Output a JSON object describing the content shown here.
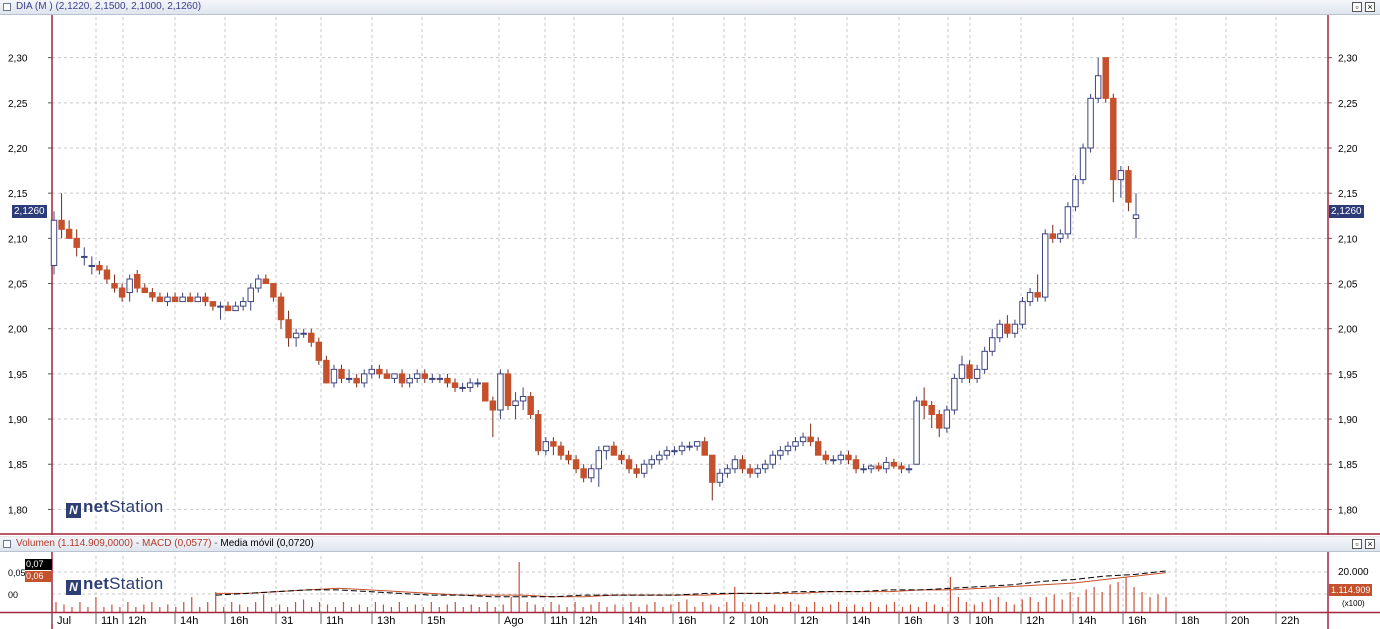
{
  "main_panel": {
    "title_symbol": "DIA (M )",
    "title_values": "(2,1220, 2,1500, 2,1000, 2,1260)",
    "last_price": "2,1260",
    "y_ticks": [
      "2,30",
      "2,25",
      "2,20",
      "2,15",
      "2,10",
      "2,05",
      "2,00",
      "1,95",
      "1,90",
      "1,85",
      "1,80"
    ],
    "logo_bold": "net",
    "logo_rest": "Station",
    "logo_mark": "N"
  },
  "lower_panel": {
    "legend_volume": "Volumen (1.114.909,0000)",
    "legend_macd": "MACD (0,0577)",
    "legend_ma": "Media móvil (0,0720)",
    "left_tag_top": "0,07",
    "left_tag_bottom": "0,06",
    "left_zero": "00",
    "left_mid": "0,05",
    "right_tick": "20.000",
    "right_tag": "1.114.909",
    "right_scale": "(x100)"
  },
  "x_axis_labels": [
    "Jul",
    "11h",
    "12h",
    "14h",
    "16h",
    "31",
    "11h",
    "13h",
    "15h",
    "Ago",
    "11h",
    "12h",
    "14h",
    "16h",
    "2",
    "10h",
    "12h",
    "14h",
    "16h",
    "3",
    "10h",
    "12h",
    "14h",
    "16h",
    "18h",
    "20h",
    "22h"
  ],
  "colors": {
    "up_body": "#ffffff",
    "up_border": "#3c4480",
    "down_body": "#c4502c",
    "grid": "#c8c8c8",
    "accent_axis": "#a6243c",
    "volume_bar": "#c8503a"
  },
  "chart_data": {
    "type": "candlestick",
    "ylim": [
      1.775,
      2.345
    ],
    "candles_ohlc": [
      [
        2.07,
        2.13,
        2.06,
        2.12
      ],
      [
        2.12,
        2.15,
        2.1,
        2.11
      ],
      [
        2.11,
        2.12,
        2.1,
        2.1
      ],
      [
        2.1,
        2.11,
        2.08,
        2.09
      ],
      [
        2.08,
        2.09,
        2.07,
        2.08
      ],
      [
        2.07,
        2.08,
        2.06,
        2.07
      ],
      [
        2.07,
        2.075,
        2.06,
        2.065
      ],
      [
        2.065,
        2.07,
        2.05,
        2.055
      ],
      [
        2.05,
        2.06,
        2.04,
        2.045
      ],
      [
        2.045,
        2.05,
        2.03,
        2.035
      ],
      [
        2.04,
        2.06,
        2.03,
        2.055
      ],
      [
        2.06,
        2.065,
        2.04,
        2.045
      ],
      [
        2.045,
        2.05,
        2.04,
        2.04
      ],
      [
        2.04,
        2.045,
        2.03,
        2.035
      ],
      [
        2.035,
        2.04,
        2.03,
        2.03
      ],
      [
        2.03,
        2.04,
        2.025,
        2.035
      ],
      [
        2.035,
        2.04,
        2.03,
        2.03
      ],
      [
        2.03,
        2.04,
        2.03,
        2.035
      ],
      [
        2.035,
        2.04,
        2.03,
        2.03
      ],
      [
        2.03,
        2.04,
        2.03,
        2.035
      ],
      [
        2.035,
        2.04,
        2.025,
        2.03
      ],
      [
        2.03,
        2.03,
        2.02,
        2.025
      ],
      [
        2.025,
        2.03,
        2.01,
        2.025
      ],
      [
        2.025,
        2.03,
        2.02,
        2.02
      ],
      [
        2.02,
        2.03,
        2.02,
        2.025
      ],
      [
        2.025,
        2.035,
        2.02,
        2.03
      ],
      [
        2.03,
        2.05,
        2.02,
        2.045
      ],
      [
        2.045,
        2.06,
        2.04,
        2.055
      ],
      [
        2.055,
        2.06,
        2.05,
        2.05
      ],
      [
        2.05,
        2.05,
        2.03,
        2.035
      ],
      [
        2.035,
        2.04,
        2.0,
        2.01
      ],
      [
        2.01,
        2.02,
        1.98,
        1.99
      ],
      [
        1.99,
        2.0,
        1.98,
        1.995
      ],
      [
        1.995,
        2.0,
        1.99,
        1.995
      ],
      [
        1.995,
        2.0,
        1.98,
        1.985
      ],
      [
        1.985,
        1.99,
        1.96,
        1.965
      ],
      [
        1.965,
        1.97,
        1.94,
        1.94
      ],
      [
        1.94,
        1.96,
        1.935,
        1.955
      ],
      [
        1.955,
        1.96,
        1.94,
        1.945
      ],
      [
        1.945,
        1.955,
        1.94,
        1.945
      ],
      [
        1.945,
        1.95,
        1.935,
        1.94
      ],
      [
        1.94,
        1.955,
        1.935,
        1.95
      ],
      [
        1.95,
        1.96,
        1.945,
        1.955
      ],
      [
        1.955,
        1.96,
        1.945,
        1.95
      ],
      [
        1.95,
        1.955,
        1.945,
        1.945
      ],
      [
        1.945,
        1.95,
        1.94,
        1.95
      ],
      [
        1.95,
        1.955,
        1.935,
        1.94
      ],
      [
        1.94,
        1.95,
        1.935,
        1.945
      ],
      [
        1.945,
        1.955,
        1.94,
        1.95
      ],
      [
        1.95,
        1.955,
        1.94,
        1.945
      ],
      [
        1.945,
        1.95,
        1.94,
        1.945
      ],
      [
        1.945,
        1.95,
        1.94,
        1.945
      ],
      [
        1.945,
        1.95,
        1.935,
        1.94
      ],
      [
        1.94,
        1.945,
        1.93,
        1.935
      ],
      [
        1.935,
        1.94,
        1.93,
        1.935
      ],
      [
        1.935,
        1.945,
        1.93,
        1.94
      ],
      [
        1.94,
        1.945,
        1.935,
        1.94
      ],
      [
        1.94,
        1.94,
        1.92,
        1.92
      ],
      [
        1.92,
        1.925,
        1.88,
        1.91
      ],
      [
        1.91,
        1.955,
        1.9,
        1.95
      ],
      [
        1.95,
        1.955,
        1.91,
        1.915
      ],
      [
        1.915,
        1.93,
        1.9,
        1.92
      ],
      [
        1.92,
        1.935,
        1.91,
        1.925
      ],
      [
        1.925,
        1.93,
        1.9,
        1.905
      ],
      [
        1.905,
        1.91,
        1.86,
        1.865
      ],
      [
        1.865,
        1.88,
        1.86,
        1.875
      ],
      [
        1.875,
        1.88,
        1.86,
        1.87
      ],
      [
        1.87,
        1.875,
        1.855,
        1.86
      ],
      [
        1.86,
        1.865,
        1.85,
        1.855
      ],
      [
        1.855,
        1.86,
        1.84,
        1.845
      ],
      [
        1.845,
        1.85,
        1.83,
        1.835
      ],
      [
        1.835,
        1.85,
        1.83,
        1.845
      ],
      [
        1.845,
        1.87,
        1.825,
        1.865
      ],
      [
        1.865,
        1.87,
        1.855,
        1.87
      ],
      [
        1.87,
        1.875,
        1.86,
        1.86
      ],
      [
        1.86,
        1.865,
        1.85,
        1.855
      ],
      [
        1.855,
        1.86,
        1.84,
        1.845
      ],
      [
        1.845,
        1.85,
        1.835,
        1.84
      ],
      [
        1.84,
        1.855,
        1.835,
        1.85
      ],
      [
        1.85,
        1.86,
        1.845,
        1.855
      ],
      [
        1.855,
        1.865,
        1.85,
        1.86
      ],
      [
        1.86,
        1.87,
        1.855,
        1.865
      ],
      [
        1.865,
        1.87,
        1.86,
        1.865
      ],
      [
        1.865,
        1.875,
        1.86,
        1.87
      ],
      [
        1.87,
        1.875,
        1.865,
        1.87
      ],
      [
        1.87,
        1.875,
        1.865,
        1.875
      ],
      [
        1.875,
        1.88,
        1.86,
        1.86
      ],
      [
        1.86,
        1.86,
        1.81,
        1.83
      ],
      [
        1.83,
        1.845,
        1.825,
        1.84
      ],
      [
        1.84,
        1.85,
        1.835,
        1.845
      ],
      [
        1.845,
        1.86,
        1.84,
        1.855
      ],
      [
        1.855,
        1.86,
        1.84,
        1.845
      ],
      [
        1.845,
        1.85,
        1.835,
        1.84
      ],
      [
        1.84,
        1.85,
        1.835,
        1.845
      ],
      [
        1.845,
        1.855,
        1.84,
        1.85
      ],
      [
        1.85,
        1.865,
        1.845,
        1.86
      ],
      [
        1.86,
        1.87,
        1.855,
        1.865
      ],
      [
        1.865,
        1.875,
        1.86,
        1.87
      ],
      [
        1.87,
        1.88,
        1.865,
        1.875
      ],
      [
        1.875,
        1.885,
        1.87,
        1.88
      ],
      [
        1.88,
        1.895,
        1.87,
        1.875
      ],
      [
        1.875,
        1.88,
        1.86,
        1.86
      ],
      [
        1.86,
        1.865,
        1.85,
        1.855
      ],
      [
        1.855,
        1.86,
        1.85,
        1.855
      ],
      [
        1.855,
        1.865,
        1.85,
        1.86
      ],
      [
        1.86,
        1.865,
        1.85,
        1.855
      ],
      [
        1.855,
        1.86,
        1.84,
        1.845
      ],
      [
        1.845,
        1.85,
        1.84,
        1.845
      ],
      [
        1.845,
        1.85,
        1.84,
        1.848
      ],
      [
        1.848,
        1.852,
        1.842,
        1.845
      ],
      [
        1.845,
        1.858,
        1.84,
        1.852
      ],
      [
        1.852,
        1.856,
        1.845,
        1.848
      ],
      [
        1.848,
        1.852,
        1.84,
        1.845
      ],
      [
        1.845,
        1.85,
        1.84,
        1.845
      ],
      [
        1.85,
        1.925,
        1.85,
        1.92
      ],
      [
        1.92,
        1.935,
        1.9,
        1.915
      ],
      [
        1.915,
        1.92,
        1.89,
        1.905
      ],
      [
        1.905,
        1.91,
        1.88,
        1.89
      ],
      [
        1.89,
        1.915,
        1.885,
        1.91
      ],
      [
        1.91,
        1.95,
        1.905,
        1.945
      ],
      [
        1.945,
        1.97,
        1.94,
        1.96
      ],
      [
        1.96,
        1.965,
        1.94,
        1.945
      ],
      [
        1.945,
        1.96,
        1.94,
        1.955
      ],
      [
        1.955,
        1.98,
        1.95,
        1.975
      ],
      [
        1.975,
        2.0,
        1.97,
        1.99
      ],
      [
        1.99,
        2.01,
        1.985,
        2.005
      ],
      [
        2.005,
        2.015,
        1.99,
        1.995
      ],
      [
        1.995,
        2.01,
        1.99,
        2.005
      ],
      [
        2.005,
        2.035,
        2.0,
        2.03
      ],
      [
        2.03,
        2.045,
        2.025,
        2.04
      ],
      [
        2.04,
        2.06,
        2.03,
        2.035
      ],
      [
        2.035,
        2.11,
        2.03,
        2.105
      ],
      [
        2.105,
        2.115,
        2.095,
        2.1
      ],
      [
        2.1,
        2.11,
        2.095,
        2.105
      ],
      [
        2.105,
        2.14,
        2.1,
        2.135
      ],
      [
        2.135,
        2.17,
        2.13,
        2.165
      ],
      [
        2.165,
        2.205,
        2.16,
        2.2
      ],
      [
        2.2,
        2.26,
        2.195,
        2.255
      ],
      [
        2.255,
        2.3,
        2.25,
        2.28
      ],
      [
        2.3,
        2.3,
        2.25,
        2.255
      ],
      [
        2.255,
        2.26,
        2.14,
        2.165
      ],
      [
        2.165,
        2.18,
        2.145,
        2.175
      ],
      [
        2.175,
        2.18,
        2.13,
        2.14
      ],
      [
        2.122,
        2.15,
        2.1,
        2.126
      ]
    ],
    "macd_line": [
      0.054,
      0.055,
      0.056,
      0.057,
      0.057,
      0.056,
      0.055,
      0.054,
      0.054,
      0.053,
      0.053,
      0.053,
      0.054,
      0.054,
      0.054,
      0.054,
      0.055,
      0.055,
      0.055,
      0.056,
      0.056,
      0.056,
      0.057,
      0.057,
      0.058,
      0.059,
      0.06,
      0.062,
      0.063,
      0.065,
      0.066,
      0.068
    ],
    "macd_signal": [
      0.055,
      0.055,
      0.056,
      0.057,
      0.058,
      0.057,
      0.056,
      0.055,
      0.054,
      0.054,
      0.054,
      0.053,
      0.053,
      0.054,
      0.054,
      0.054,
      0.054,
      0.055,
      0.055,
      0.055,
      0.056,
      0.056,
      0.056,
      0.057,
      0.057,
      0.058,
      0.059,
      0.06,
      0.061,
      0.063,
      0.065,
      0.067
    ],
    "volume_relative": [
      0.2,
      0.15,
      0.1,
      0.2,
      0.1,
      0.3,
      0.1,
      0.15,
      0.1,
      0.2,
      0.1,
      0.15,
      0.2,
      0.1,
      0.15,
      0.1,
      0.2,
      0.3,
      0.1,
      0.2,
      0.4,
      0.1,
      0.2,
      0.15,
      0.1,
      0.2,
      0.35,
      0.1,
      0.15,
      0.1,
      0.2,
      0.25,
      0.1,
      0.2,
      0.15,
      0.1,
      0.2,
      0.1,
      0.15,
      0.1,
      0.2,
      0.15,
      0.1,
      0.2,
      0.1,
      0.15,
      0.1,
      0.2,
      0.1,
      0.15,
      0.2,
      0.1,
      0.15,
      0.1,
      0.2,
      0.1,
      0.15,
      0.3,
      1.0,
      0.2,
      0.15,
      0.1,
      0.2,
      0.15,
      0.1,
      0.2,
      0.1,
      0.15,
      0.2,
      0.1,
      0.15,
      0.1,
      0.2,
      0.1,
      0.15,
      0.2,
      0.1,
      0.15,
      0.2,
      0.25,
      0.1,
      0.2,
      0.15,
      0.1,
      0.2,
      0.5,
      0.2,
      0.15,
      0.2,
      0.1,
      0.15,
      0.1,
      0.2,
      0.15,
      0.1,
      0.2,
      0.1,
      0.15,
      0.2,
      0.1,
      0.15,
      0.1,
      0.2,
      0.1,
      0.15,
      0.2,
      0.1,
      0.15,
      0.1,
      0.2,
      0.15,
      0.1,
      0.7,
      0.3,
      0.2,
      0.15,
      0.2,
      0.25,
      0.3,
      0.2,
      0.15,
      0.25,
      0.3,
      0.2,
      0.3,
      0.35,
      0.25,
      0.4,
      0.3,
      0.45,
      0.5,
      0.4,
      0.55,
      0.6,
      0.7,
      0.5,
      0.4,
      0.3,
      0.35,
      0.3
    ]
  }
}
